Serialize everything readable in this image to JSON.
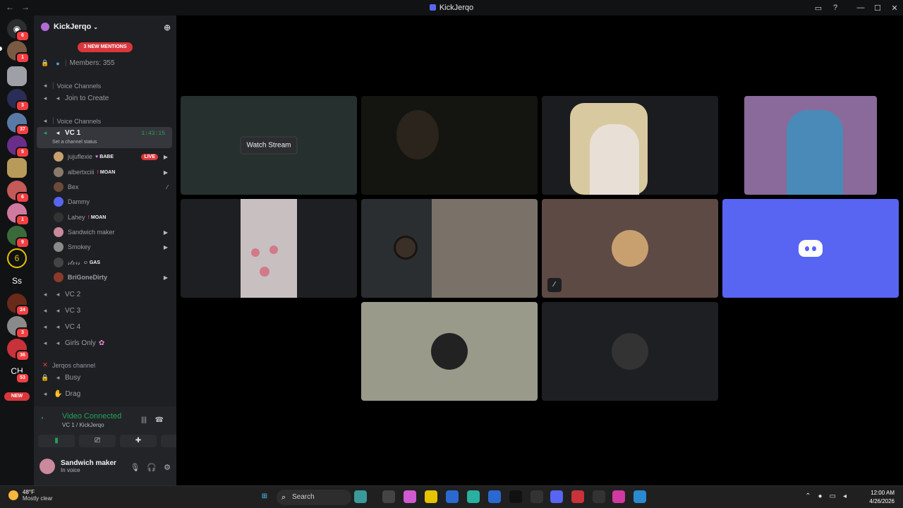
{
  "window": {
    "title": "KickJerqo"
  },
  "server": {
    "name": "KickJerqo",
    "mentions_banner": "3 NEW MENTIONS",
    "members": "Members: 355"
  },
  "channels": {
    "cat1": "Voice Channels",
    "join_to_create": "Join to Create",
    "cat2": "Voice Channels",
    "vc1": {
      "name": "VC 1",
      "timer": "1:43:15",
      "status": "Set a channel status"
    },
    "users": [
      {
        "name": "jujuflexie",
        "tag": "BABE",
        "live": "LIVE"
      },
      {
        "name": "albertxciii",
        "tag": "MOAN"
      },
      {
        "name": "Bex"
      },
      {
        "name": "Dammy"
      },
      {
        "name": "Lahey",
        "tag": "MOAN"
      },
      {
        "name": "Sandwich maker"
      },
      {
        "name": "Smokey"
      },
      {
        "name": "𝓈𝓉𝓍𝓇𝓈",
        "tag": "GAS"
      },
      {
        "name": "BriGoneDirty"
      }
    ],
    "vc2": "VC 2",
    "vc3": "VC 3",
    "vc4": "VC 4",
    "girls_only": "Girls Only",
    "cat3": "Jerqos channel",
    "busy": "Busy",
    "drag": "Drag"
  },
  "guild_badges": [
    "6",
    "1",
    "3",
    "37",
    "5",
    "6",
    "1",
    "9",
    "24",
    "3",
    "36",
    "53"
  ],
  "guild_texts": {
    "ss": "Ss",
    "ch": "CH",
    "new": "NEW"
  },
  "voice_panel": {
    "status": "Video Connected",
    "location": "VC 1 / KickJerqo"
  },
  "user_panel": {
    "name": "Sandwich maker",
    "status": "In voice"
  },
  "stage": {
    "watch_stream": "Watch Stream"
  },
  "taskbar": {
    "temp": "48°F",
    "condition": "Mostly clear",
    "search": "Search",
    "time": "12:00 AM",
    "date": "4/26/2026"
  },
  "colors": {
    "accent": "#5865f2",
    "green": "#23a55a",
    "red": "#da373c"
  }
}
